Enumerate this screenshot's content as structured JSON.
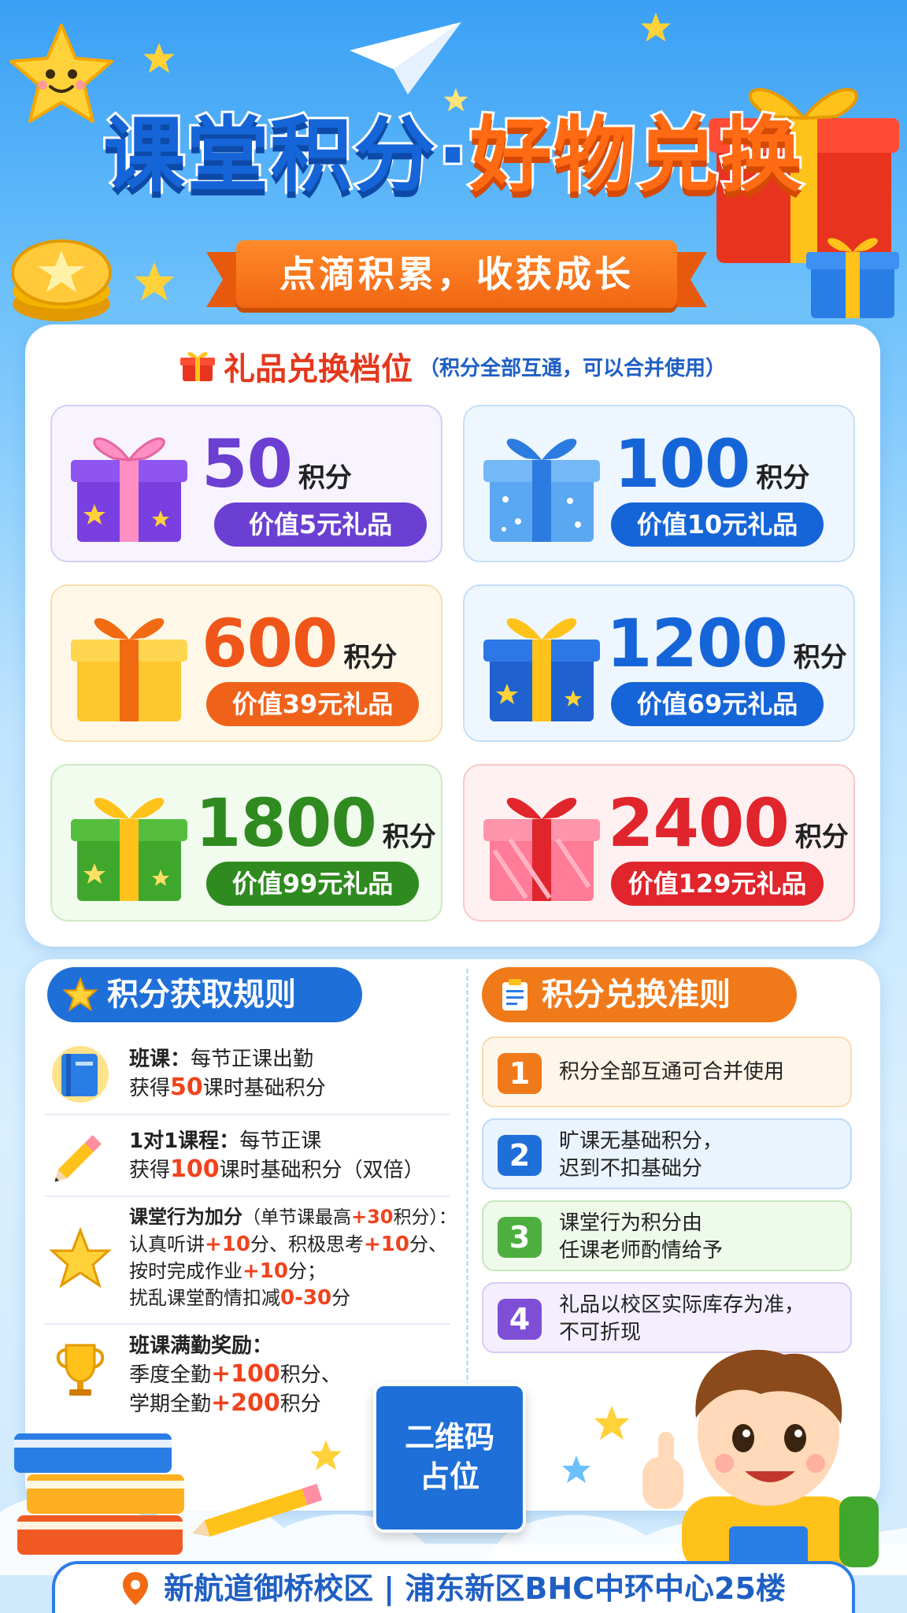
{
  "header": {
    "title_part1": "课堂积分",
    "title_dot": "·",
    "title_part2": "好物兑换",
    "ribbon": "点滴积累，收获成长"
  },
  "gift_section": {
    "title": "礼品兑换档位",
    "subtitle": "（积分全部互通，可以合并使用）",
    "unit": "积分",
    "tiers": [
      {
        "points": "50",
        "value": "价值5元礼品",
        "color": "#6a3fd1"
      },
      {
        "points": "100",
        "value": "价值10元礼品",
        "color": "#1565d8"
      },
      {
        "points": "600",
        "value": "价值39元礼品",
        "color": "#f0551a"
      },
      {
        "points": "1200",
        "value": "价值69元礼品",
        "color": "#1565d8"
      },
      {
        "points": "1800",
        "value": "价值99元礼品",
        "color": "#2f8a1f"
      },
      {
        "points": "2400",
        "value": "价值129元礼品",
        "color": "#e0252c"
      }
    ]
  },
  "earn_rules": {
    "title": "积分获取规则",
    "items": [
      {
        "line1_bold": "班课：",
        "line1": "每节正课出勤",
        "line2_pre": "获得",
        "line2_em": "50",
        "line2_post": "课时基础积分"
      },
      {
        "line1_bold": "1对1课程：",
        "line1": "每节正课",
        "line2_pre": "获得",
        "line2_em": "100",
        "line2_post": "课时基础积分（双倍）"
      },
      {
        "line1_bold": "课堂行为加分",
        "line1_small_pre": "（单节课最高",
        "line1_small_em": "+30",
        "line1_small_post": "积分）：",
        "line2_pre": "认真听讲",
        "line2_em1": "+10",
        "line2_mid": "分、积极思考",
        "line2_em2": "+10",
        "line2_post": "分、",
        "line3_pre": "按时完成作业",
        "line3_em": "+10",
        "line3_post": "分；",
        "line4_pre": "扰乱课堂酌情扣减",
        "line4_em": "0-30",
        "line4_post": "分"
      },
      {
        "line1_bold": "班课满勤奖励：",
        "line2_pre": "季度全勤",
        "line2_em": "+100",
        "line2_post": "积分、",
        "line3_pre": "学期全勤",
        "line3_em": "+200",
        "line3_post": "积分"
      }
    ]
  },
  "exchange_rules": {
    "title": "积分兑换准则",
    "items": [
      {
        "num": "1",
        "line1": "积分全部互通可合并使用",
        "line2": "",
        "color": "#f07a1a",
        "bg": "#fff6ea",
        "border": "#fbd9b0"
      },
      {
        "num": "2",
        "line1": "旷课无基础积分，",
        "line2": "迟到不扣基础分",
        "color": "#1f6fd8",
        "bg": "#eaf4ff",
        "border": "#bcdaf7"
      },
      {
        "num": "3",
        "line1": "课堂行为积分由",
        "line2": "任课老师酌情给予",
        "color": "#4caf3e",
        "bg": "#eefaea",
        "border": "#c7e9bf"
      },
      {
        "num": "4",
        "line1": "礼品以校区实际库存为准，",
        "line2": "不可折现",
        "color": "#7e4fd6",
        "bg": "#f4efff",
        "border": "#d9cbf5"
      }
    ]
  },
  "qr": {
    "line1": "二维码",
    "line2": "占位"
  },
  "footer": {
    "address": "新航道御桥校区 | 浦东新区BHC中环中心25楼"
  },
  "colors": {
    "blue": "#1565d8",
    "orange": "#ff6a13",
    "red": "#e4381d"
  }
}
